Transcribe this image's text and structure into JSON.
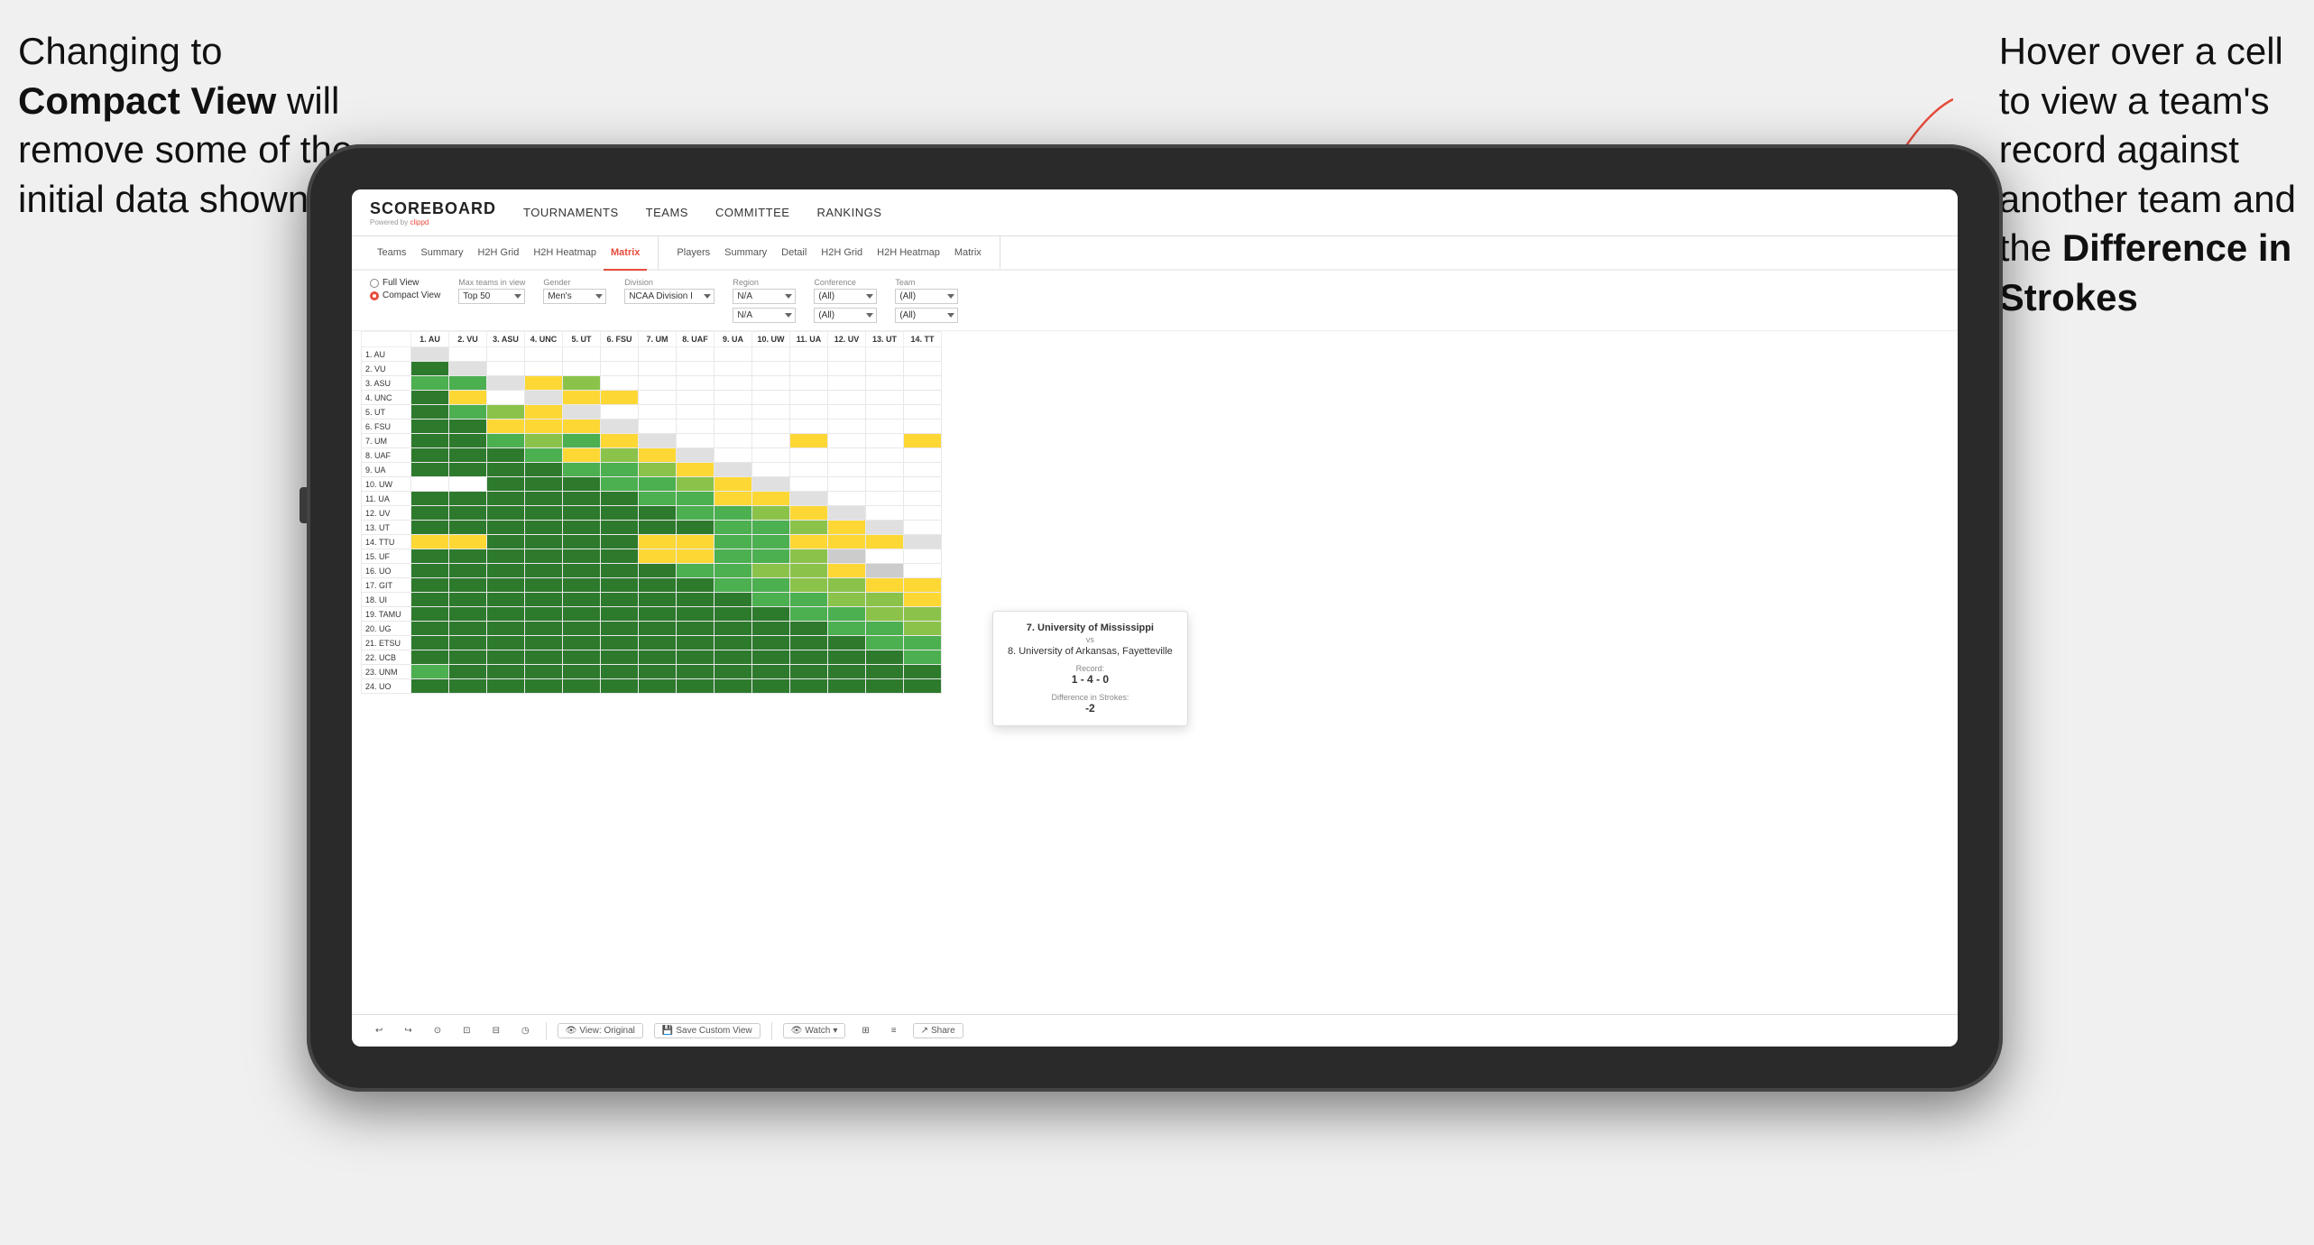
{
  "annotations": {
    "left_line1": "Changing to",
    "left_line2": "Compact View will",
    "left_line3": "remove some of the",
    "left_line4": "initial data shown",
    "right_line1": "Hover over a cell",
    "right_line2": "to view a team's",
    "right_line3": "record against",
    "right_line4": "another team and",
    "right_line5": "the ",
    "right_bold": "Difference in Strokes"
  },
  "navbar": {
    "logo": "SCOREBOARD",
    "logo_sub": "Powered by clippd",
    "nav_items": [
      "TOURNAMENTS",
      "TEAMS",
      "COMMITTEE",
      "RANKINGS"
    ]
  },
  "tabs": {
    "group1": {
      "label": "Teams",
      "items": [
        "Summary",
        "H2H Grid",
        "H2H Heatmap",
        "Matrix"
      ]
    },
    "group2": {
      "label": "Players",
      "items": [
        "Summary",
        "Detail",
        "H2H Grid",
        "H2H Heatmap",
        "Matrix"
      ]
    }
  },
  "active_tab": "Matrix",
  "controls": {
    "view_full": "Full View",
    "view_compact": "Compact View",
    "selected_view": "compact",
    "filters": [
      {
        "label": "Max teams in view",
        "value": "Top 50"
      },
      {
        "label": "Gender",
        "value": "Men's"
      },
      {
        "label": "Division",
        "value": "NCAA Division I"
      },
      {
        "label": "Region",
        "value": "N/A"
      },
      {
        "label": "Conference",
        "value": "(All)"
      },
      {
        "label": "Team",
        "value": "(All)"
      }
    ]
  },
  "matrix": {
    "col_headers": [
      "1. AU",
      "2. VU",
      "3. ASU",
      "4. UNC",
      "5. UT",
      "6. FSU",
      "7. UM",
      "8. UAF",
      "9. UA",
      "10. UW",
      "11. UA",
      "12. UV",
      "13. UT",
      "14. TT"
    ],
    "rows": [
      {
        "label": "1. AU",
        "cells": [
          "diag",
          "white",
          "white",
          "white",
          "white",
          "white",
          "white",
          "white",
          "white",
          "white",
          "white",
          "white",
          "white",
          "white"
        ]
      },
      {
        "label": "2. VU",
        "cells": [
          "green-dark",
          "diag",
          "white",
          "white",
          "white",
          "white",
          "white",
          "white",
          "white",
          "white",
          "white",
          "white",
          "white",
          "white"
        ]
      },
      {
        "label": "3. ASU",
        "cells": [
          "green-mid",
          "green-mid",
          "diag",
          "yellow",
          "green-light",
          "white",
          "white",
          "white",
          "white",
          "white",
          "white",
          "white",
          "white",
          "white"
        ]
      },
      {
        "label": "4. UNC",
        "cells": [
          "green-dark",
          "yellow",
          "white",
          "diag",
          "yellow",
          "yellow",
          "white",
          "white",
          "white",
          "white",
          "white",
          "white",
          "white",
          "white"
        ]
      },
      {
        "label": "5. UT",
        "cells": [
          "green-dark",
          "green-mid",
          "green-light",
          "yellow",
          "diag",
          "white",
          "white",
          "white",
          "white",
          "white",
          "white",
          "white",
          "white",
          "white"
        ]
      },
      {
        "label": "6. FSU",
        "cells": [
          "green-dark",
          "green-dark",
          "yellow",
          "yellow",
          "yellow",
          "diag",
          "white",
          "white",
          "white",
          "white",
          "white",
          "white",
          "white",
          "white"
        ]
      },
      {
        "label": "7. UM",
        "cells": [
          "green-dark",
          "green-dark",
          "green-mid",
          "green-light",
          "green-mid",
          "yellow",
          "diag",
          "white",
          "white",
          "white",
          "yellow",
          "white",
          "white",
          "yellow"
        ]
      },
      {
        "label": "8. UAF",
        "cells": [
          "green-dark",
          "green-dark",
          "green-dark",
          "green-mid",
          "yellow",
          "green-light",
          "yellow",
          "diag",
          "white",
          "white",
          "white",
          "white",
          "white",
          "white"
        ]
      },
      {
        "label": "9. UA",
        "cells": [
          "green-dark",
          "green-dark",
          "green-dark",
          "green-dark",
          "green-mid",
          "green-mid",
          "green-light",
          "yellow",
          "diag",
          "white",
          "white",
          "white",
          "white",
          "white"
        ]
      },
      {
        "label": "10. UW",
        "cells": [
          "white",
          "white",
          "green-dark",
          "green-dark",
          "green-dark",
          "green-mid",
          "green-mid",
          "green-light",
          "yellow",
          "diag",
          "white",
          "white",
          "white",
          "white"
        ]
      },
      {
        "label": "11. UA",
        "cells": [
          "green-dark",
          "green-dark",
          "green-dark",
          "green-dark",
          "green-dark",
          "green-dark",
          "green-mid",
          "green-mid",
          "yellow",
          "yellow",
          "diag",
          "white",
          "white",
          "white"
        ]
      },
      {
        "label": "12. UV",
        "cells": [
          "green-dark",
          "green-dark",
          "green-dark",
          "green-dark",
          "green-dark",
          "green-dark",
          "green-dark",
          "green-mid",
          "green-mid",
          "green-light",
          "yellow",
          "diag",
          "white",
          "white"
        ]
      },
      {
        "label": "13. UT",
        "cells": [
          "green-dark",
          "green-dark",
          "green-dark",
          "green-dark",
          "green-dark",
          "green-dark",
          "green-dark",
          "green-dark",
          "green-mid",
          "green-mid",
          "green-light",
          "yellow",
          "diag",
          "white"
        ]
      },
      {
        "label": "14. TTU",
        "cells": [
          "yellow",
          "yellow",
          "green-dark",
          "green-dark",
          "green-dark",
          "green-dark",
          "yellow",
          "yellow",
          "green-mid",
          "green-mid",
          "yellow",
          "yellow",
          "yellow",
          "diag"
        ]
      },
      {
        "label": "15. UF",
        "cells": [
          "green-dark",
          "green-dark",
          "green-dark",
          "green-dark",
          "green-dark",
          "green-dark",
          "yellow",
          "yellow",
          "green-mid",
          "green-mid",
          "green-light",
          "gray",
          "white",
          "white"
        ]
      },
      {
        "label": "16. UO",
        "cells": [
          "green-dark",
          "green-dark",
          "green-dark",
          "green-dark",
          "green-dark",
          "green-dark",
          "green-dark",
          "green-mid",
          "green-mid",
          "green-light",
          "green-light",
          "yellow",
          "gray",
          "white"
        ]
      },
      {
        "label": "17. GIT",
        "cells": [
          "green-dark",
          "green-dark",
          "green-dark",
          "green-dark",
          "green-dark",
          "green-dark",
          "green-dark",
          "green-dark",
          "green-mid",
          "green-mid",
          "green-light",
          "green-light",
          "yellow",
          "yellow"
        ]
      },
      {
        "label": "18. UI",
        "cells": [
          "green-dark",
          "green-dark",
          "green-dark",
          "green-dark",
          "green-dark",
          "green-dark",
          "green-dark",
          "green-dark",
          "green-dark",
          "green-mid",
          "green-mid",
          "green-light",
          "green-light",
          "yellow"
        ]
      },
      {
        "label": "19. TAMU",
        "cells": [
          "green-dark",
          "green-dark",
          "green-dark",
          "green-dark",
          "green-dark",
          "green-dark",
          "green-dark",
          "green-dark",
          "green-dark",
          "green-dark",
          "green-mid",
          "green-mid",
          "green-light",
          "green-light"
        ]
      },
      {
        "label": "20. UG",
        "cells": [
          "green-dark",
          "green-dark",
          "green-dark",
          "green-dark",
          "green-dark",
          "green-dark",
          "green-dark",
          "green-dark",
          "green-dark",
          "green-dark",
          "green-dark",
          "green-mid",
          "green-mid",
          "green-light"
        ]
      },
      {
        "label": "21. ETSU",
        "cells": [
          "green-dark",
          "green-dark",
          "green-dark",
          "green-dark",
          "green-dark",
          "green-dark",
          "green-dark",
          "green-dark",
          "green-dark",
          "green-dark",
          "green-dark",
          "green-dark",
          "green-mid",
          "green-mid"
        ]
      },
      {
        "label": "22. UCB",
        "cells": [
          "green-dark",
          "green-dark",
          "green-dark",
          "green-dark",
          "green-dark",
          "green-dark",
          "green-dark",
          "green-dark",
          "green-dark",
          "green-dark",
          "green-dark",
          "green-dark",
          "green-dark",
          "green-mid"
        ]
      },
      {
        "label": "23. UNM",
        "cells": [
          "green-mid",
          "green-dark",
          "green-dark",
          "green-dark",
          "green-dark",
          "green-dark",
          "green-dark",
          "green-dark",
          "green-dark",
          "green-dark",
          "green-dark",
          "green-dark",
          "green-dark",
          "green-dark"
        ]
      },
      {
        "label": "24. UO",
        "cells": [
          "green-dark",
          "green-dark",
          "green-dark",
          "green-dark",
          "green-dark",
          "green-dark",
          "green-dark",
          "green-dark",
          "green-dark",
          "green-dark",
          "green-dark",
          "green-dark",
          "green-dark",
          "green-dark"
        ]
      }
    ]
  },
  "tooltip": {
    "team1": "7. University of Mississippi",
    "vs": "vs",
    "team2": "8. University of Arkansas, Fayetteville",
    "record_label": "Record:",
    "record": "1 - 4 - 0",
    "diff_label": "Difference in Strokes:",
    "diff": "-2"
  },
  "toolbar": {
    "undo": "↩",
    "redo": "↪",
    "icon1": "⊙",
    "icon2": "⊡",
    "icon3": "⊟",
    "icon4": "◷",
    "view_original": "View: Original",
    "save_custom": "Save Custom View",
    "watch": "Watch",
    "share": "Share"
  }
}
